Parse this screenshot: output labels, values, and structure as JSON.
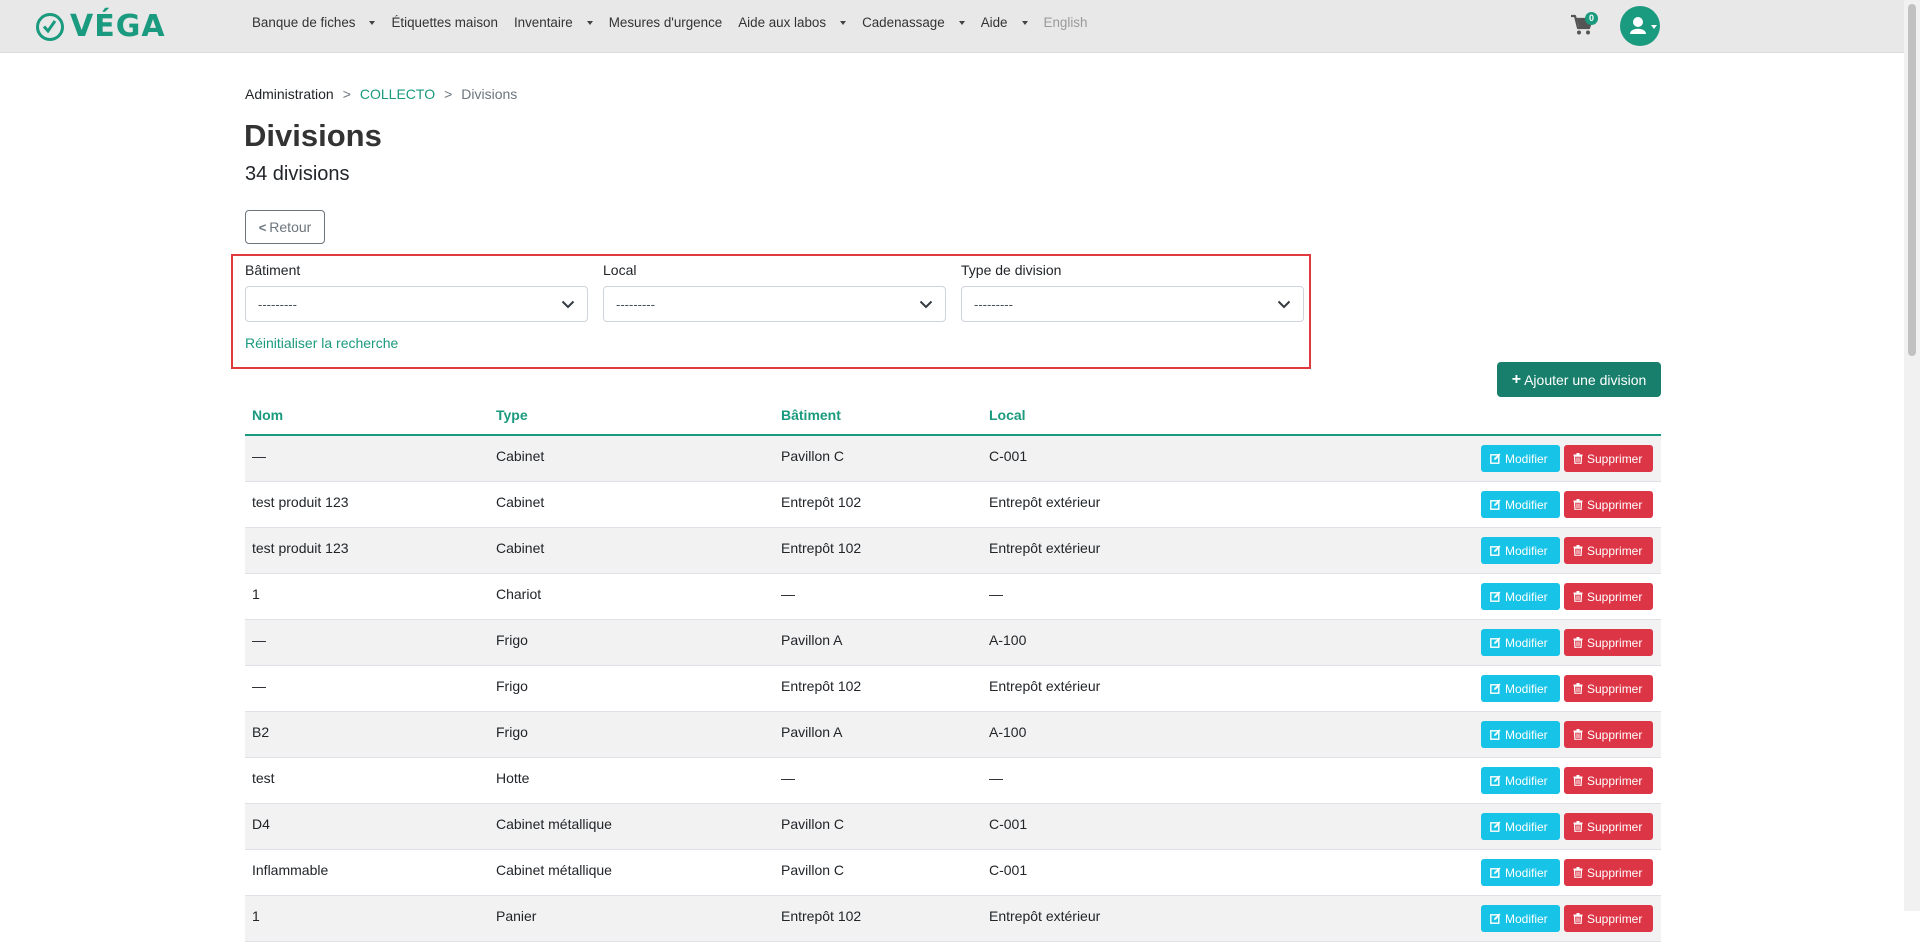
{
  "brand": {
    "logo_text": "VÉGA",
    "accent": "#1a9a7e"
  },
  "nav": {
    "items": [
      {
        "label": "Banque de fiches",
        "dropdown": true
      },
      {
        "label": "Étiquettes maison",
        "dropdown": false
      },
      {
        "label": "Inventaire",
        "dropdown": true
      },
      {
        "label": "Mesures d'urgence",
        "dropdown": false
      },
      {
        "label": "Aide aux labos",
        "dropdown": true
      },
      {
        "label": "Cadenassage",
        "dropdown": true
      },
      {
        "label": "Aide",
        "dropdown": true
      },
      {
        "label": "English",
        "dropdown": false
      }
    ],
    "cart_count": "0",
    "icons": {
      "cart": "cart-icon",
      "user": "user-icon"
    }
  },
  "breadcrumb": {
    "root": "Administration",
    "sep": ">",
    "org": "COLLECTO",
    "current": "Divisions"
  },
  "page": {
    "title": "Divisions",
    "count": "34 divisions",
    "back_label": "Retour"
  },
  "filters": {
    "building": {
      "label": "Bâtiment",
      "value": "---------"
    },
    "room": {
      "label": "Local",
      "value": "---------"
    },
    "division_type": {
      "label": "Type de division",
      "value": "---------"
    },
    "reset_label": "Réinitialiser la recherche"
  },
  "add_button": "Ajouter une division",
  "table": {
    "headers": {
      "name": "Nom",
      "type": "Type",
      "building": "Bâtiment",
      "room": "Local"
    },
    "edit_label": "Modifier",
    "delete_label": "Supprimer",
    "rows": [
      {
        "name": "—",
        "type": "Cabinet",
        "building": "Pavillon C",
        "room": "C-001"
      },
      {
        "name": "test produit 123",
        "type": "Cabinet",
        "building": "Entrepôt 102",
        "room": "Entrepôt extérieur"
      },
      {
        "name": "test produit 123",
        "type": "Cabinet",
        "building": "Entrepôt 102",
        "room": "Entrepôt extérieur"
      },
      {
        "name": "1",
        "type": "Chariot",
        "building": "—",
        "room": "—"
      },
      {
        "name": "—",
        "type": "Frigo",
        "building": "Pavillon A",
        "room": "A-100"
      },
      {
        "name": "—",
        "type": "Frigo",
        "building": "Entrepôt 102",
        "room": "Entrepôt extérieur"
      },
      {
        "name": "B2",
        "type": "Frigo",
        "building": "Pavillon A",
        "room": "A-100"
      },
      {
        "name": "test",
        "type": "Hotte",
        "building": "—",
        "room": "—"
      },
      {
        "name": "D4",
        "type": "Cabinet métallique",
        "building": "Pavillon C",
        "room": "C-001"
      },
      {
        "name": "Inflammable",
        "type": "Cabinet métallique",
        "building": "Pavillon C",
        "room": "C-001"
      },
      {
        "name": "1",
        "type": "Panier",
        "building": "Entrepôt 102",
        "room": "Entrepôt extérieur"
      }
    ]
  },
  "colors": {
    "edit": "#17c3e6",
    "delete": "#dc3545",
    "highlight_border": "#e0393e",
    "add_button": "#177f6b"
  }
}
